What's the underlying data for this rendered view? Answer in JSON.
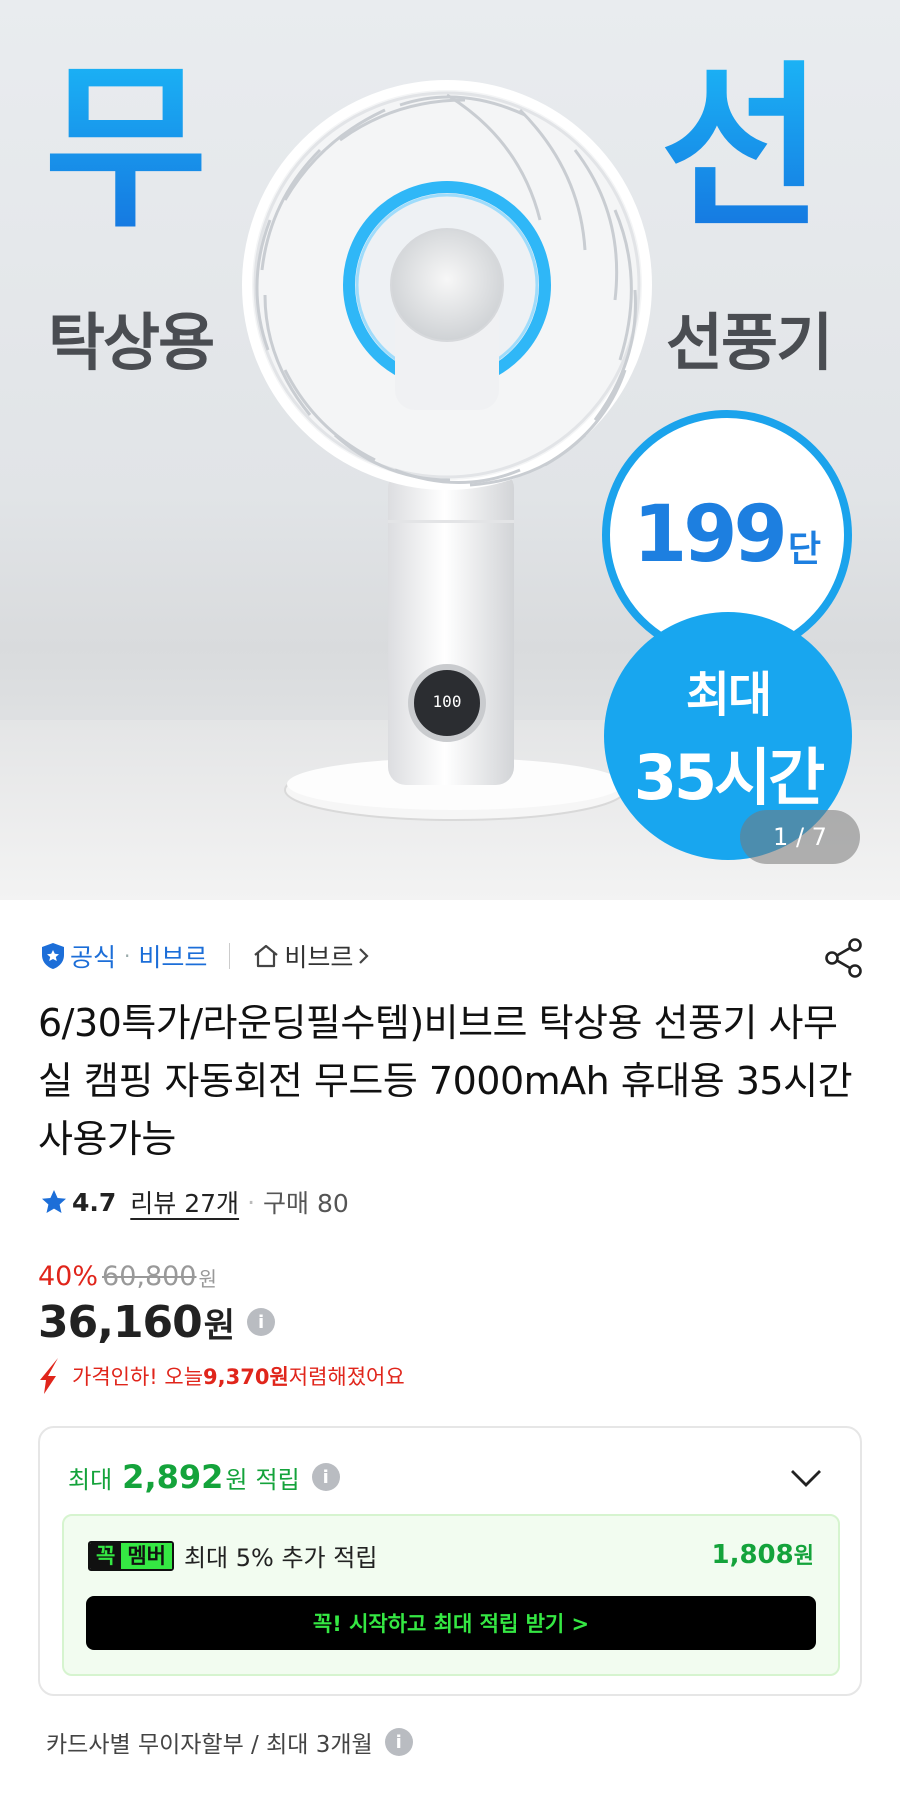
{
  "hero": {
    "char_left": "무",
    "char_right": "선",
    "word_left": "탁상용",
    "word_right": "선풍기",
    "badge_white_num": "199",
    "badge_white_unit": "단",
    "badge_blue_line1": "최대",
    "badge_blue_line2": "35시간",
    "display_value": "100",
    "counter": "1 / 7"
  },
  "store": {
    "official_label": "공식",
    "brand": "비브르",
    "store_link": "비브르",
    "share_icon": "share-icon"
  },
  "product": {
    "title": "6/30특가/라운딩필수템)비브르 탁상용 선풍기 사무실 캠핑 자동회전 무드등 7000mAh 휴대용 35시간 사용가능"
  },
  "rating": {
    "score": "4.7",
    "reviews": "리뷰 27개",
    "purchases": "구매 80"
  },
  "price": {
    "discount_pct": "40%",
    "original": "60,800",
    "original_unit": "원",
    "final": "36,160",
    "final_unit": "원",
    "drop_prefix": "가격인하! 오늘 ",
    "drop_amount": "9,370원",
    "drop_suffix": " 저렴해졌어요"
  },
  "points": {
    "max_label": "최대",
    "max_amount": "2,892",
    "unit": "원",
    "earn_label": "적립",
    "member_tag_a": "꼭",
    "member_tag_b": "멤버",
    "member_desc": "최대 5% 추가 적립",
    "member_amount": "1,808",
    "member_unit": "원",
    "cta": "꼭! 시작하고 최대 적립 받기 >"
  },
  "installment": {
    "text": "카드사별 무이자할부 / 최대 3개월"
  },
  "colors": {
    "accent_blue": "#1c6ed8",
    "sale_red": "#e0251b",
    "points_green": "#14a33b",
    "member_green": "#35e843"
  }
}
